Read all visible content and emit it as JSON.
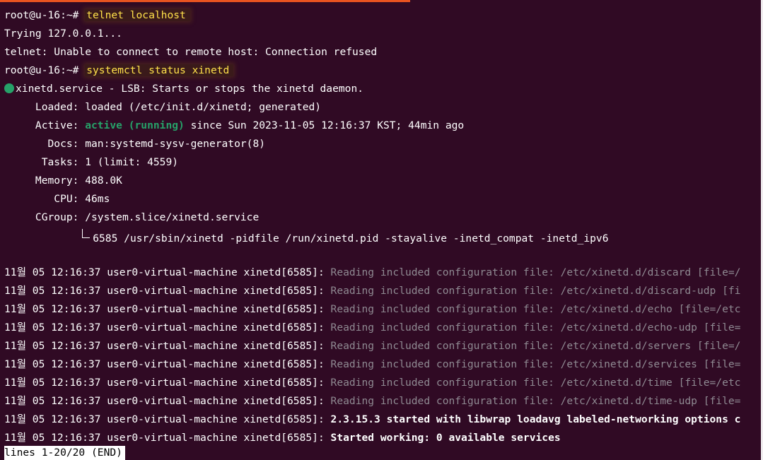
{
  "prompt": "root@u-16:~#",
  "lines": {
    "cmd1": "telnet localhost",
    "trying": "Trying 127.0.0.1...",
    "refused": "telnet: Unable to connect to remote host: Connection refused",
    "cmd2": "systemctl status xinetd",
    "service_title": "xinetd.service - LSB: Starts or stops the xinetd daemon.",
    "loaded_key": "     Loaded:",
    "loaded_val": " loaded (/etc/init.d/xinetd; generated)",
    "active_key": "     Active:",
    "active_state": "active (running)",
    "active_rest": " since Sun 2023-11-05 12:16:37 KST; 44min ago",
    "docs_key": "       Docs:",
    "docs_val": " man:systemd-sysv-generator(8)",
    "tasks_key": "      Tasks:",
    "tasks_val": " 1 (limit: 4559)",
    "memory_key": "     Memory:",
    "memory_val": " 488.0K",
    "cpu_key": "        CPU:",
    "cpu_val": " 46ms",
    "cgroup_key": "     CGroup:",
    "cgroup_val": " /system.slice/xinetd.service",
    "process_indent": "             ",
    "process": "6585 /usr/sbin/xinetd -pidfile /run/xinetd.pid -stayalive -inetd_compat -inetd_ipv6"
  },
  "log_prefix": "11월 05 12:16:37 user0-virtual-machine xinetd[6585]:",
  "logs": [
    {
      "msg": "Reading included configuration file: /etc/xinetd.d/discard [file=/",
      "style": "dim"
    },
    {
      "msg": "Reading included configuration file: /etc/xinetd.d/discard-udp [fi",
      "style": "dim"
    },
    {
      "msg": "Reading included configuration file: /etc/xinetd.d/echo [file=/etc",
      "style": "dim"
    },
    {
      "msg": "Reading included configuration file: /etc/xinetd.d/echo-udp [file=",
      "style": "dim"
    },
    {
      "msg": "Reading included configuration file: /etc/xinetd.d/servers [file=/",
      "style": "dim"
    },
    {
      "msg": "Reading included configuration file: /etc/xinetd.d/services [file=",
      "style": "dim"
    },
    {
      "msg": "Reading included configuration file: /etc/xinetd.d/time [file=/etc",
      "style": "dim"
    },
    {
      "msg": "Reading included configuration file: /etc/xinetd.d/time-udp [file=",
      "style": "dim"
    },
    {
      "msg": "2.3.15.3 started with libwrap loadavg labeled-networking options c",
      "style": "bold"
    },
    {
      "msg": "Started working: 0 available services",
      "style": "bold"
    }
  ],
  "pager": "lines 1-20/20 (END)",
  "colors": {
    "background": "#300a24",
    "accent": "#e95420",
    "command_highlight": "#ffe14a",
    "active_green": "#26a269",
    "dim_text": "#8f8a92"
  }
}
